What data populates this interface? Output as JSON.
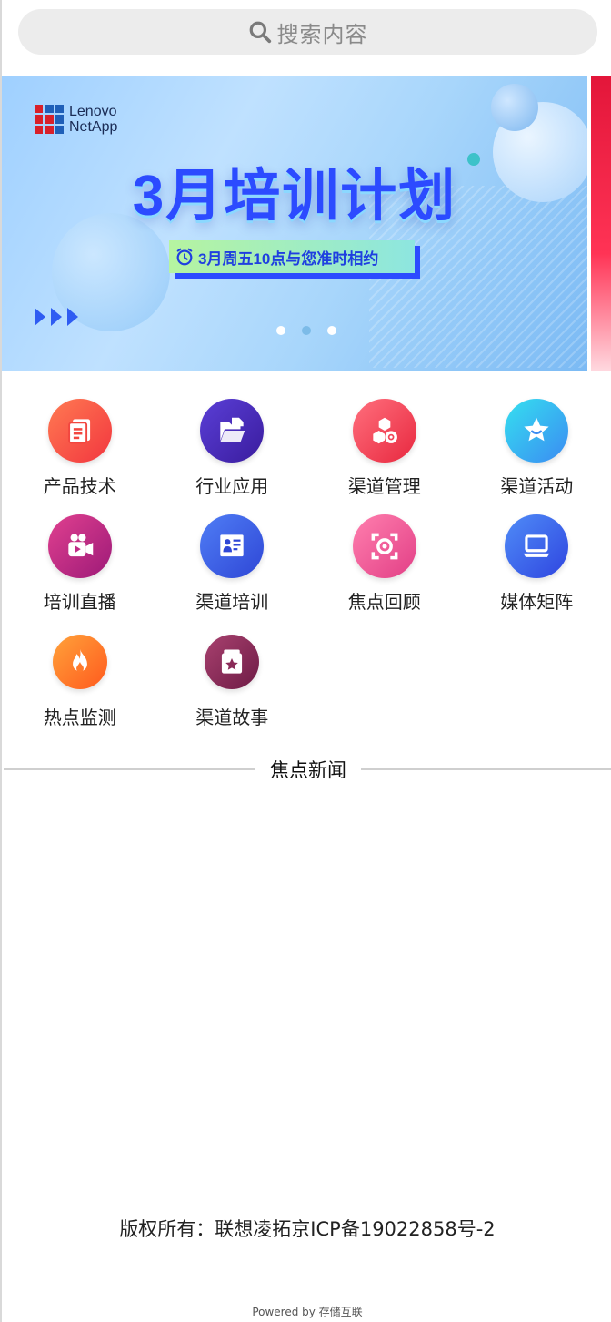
{
  "search": {
    "placeholder": "搜索内容"
  },
  "banner": {
    "logo_line1": "Lenovo",
    "logo_line2": "NetApp",
    "title": "3月培训计划",
    "subtitle": "3月周五10点与您准时相约",
    "slide_count": 3,
    "active_slide": 2
  },
  "menu": {
    "items": [
      {
        "label": "产品技术",
        "icon": "document-icon",
        "color1": "#ff7a52",
        "color2": "#f2363f"
      },
      {
        "label": "行业应用",
        "icon": "folder-icon",
        "color1": "#5a3fd6",
        "color2": "#3a1c9e"
      },
      {
        "label": "渠道管理",
        "icon": "cubes-icon",
        "color1": "#ff6f7d",
        "color2": "#e8283f"
      },
      {
        "label": "渠道活动",
        "icon": "star-icon",
        "color1": "#35e0f0",
        "color2": "#3b8bf2"
      },
      {
        "label": "培训直播",
        "icon": "video-camera-icon",
        "color1": "#e0408f",
        "color2": "#9d1a78"
      },
      {
        "label": "渠道培训",
        "icon": "presentation-icon",
        "color1": "#4f7df5",
        "color2": "#2f47d6"
      },
      {
        "label": "焦点回顾",
        "icon": "focus-icon",
        "color1": "#ff7fae",
        "color2": "#e23f86"
      },
      {
        "label": "媒体矩阵",
        "icon": "laptop-icon",
        "color1": "#4f8cf7",
        "color2": "#2f45e0"
      },
      {
        "label": "热点监测",
        "icon": "flame-icon",
        "color1": "#ffa23a",
        "color2": "#ff5a1e"
      },
      {
        "label": "渠道故事",
        "icon": "book-star-icon",
        "color1": "#a8416f",
        "color2": "#6e1b45"
      }
    ]
  },
  "section": {
    "title": "焦点新闻"
  },
  "footer": {
    "copyright": "版权所有：联想凌拓京ICP备19022858号-2",
    "powered": "Powered by 存储互联"
  }
}
